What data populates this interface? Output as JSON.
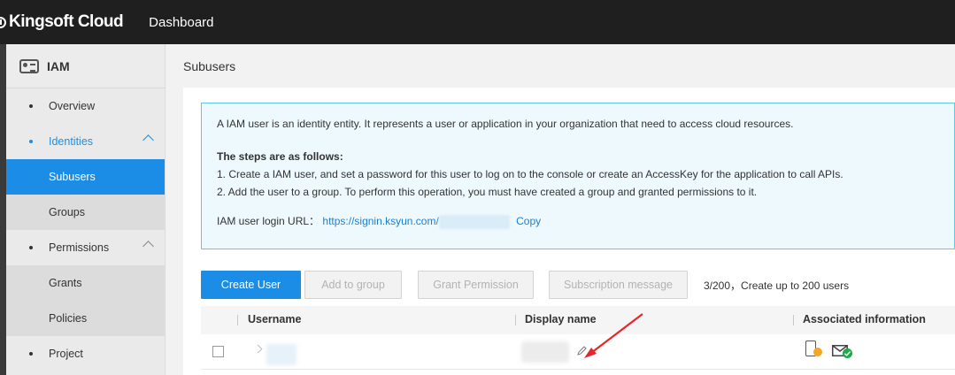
{
  "header": {
    "brand": "Kingsoft Cloud",
    "nav_dashboard": "Dashboard"
  },
  "sidebar": {
    "title": "IAM",
    "items": [
      {
        "label": "Overview"
      },
      {
        "label": "Identities"
      },
      {
        "label": "Subusers"
      },
      {
        "label": "Groups"
      },
      {
        "label": "Permissions"
      },
      {
        "label": "Grants"
      },
      {
        "label": "Policies"
      },
      {
        "label": "Project"
      }
    ]
  },
  "page": {
    "title": "Subusers"
  },
  "info": {
    "description": "A IAM user is an identity entity. It represents a user or application in your organization that need to access cloud resources.",
    "steps_title": "The steps are as follows:",
    "step1": "1. Create a IAM user, and set a password for this user to log on to the console or create an AccessKey for the application to call APIs.",
    "step2": "2. Add the user to a group. To perform this operation, you must have created a group and granted permissions to it.",
    "login_label": "IAM user login URL：",
    "login_url": "https://signin.ksyun.com/",
    "copy_label": "Copy"
  },
  "toolbar": {
    "create_user": "Create User",
    "add_to_group": "Add to group",
    "grant_permission": "Grant Permission",
    "subscription_message": "Subscription message",
    "quota": "3/200，Create up to 200 users"
  },
  "table": {
    "columns": [
      "Username",
      "Display name",
      "Associated information"
    ]
  },
  "colors": {
    "primary": "#1c8de6",
    "info_border": "#5ec6ea",
    "annotation_arrow": "#e8262a"
  }
}
